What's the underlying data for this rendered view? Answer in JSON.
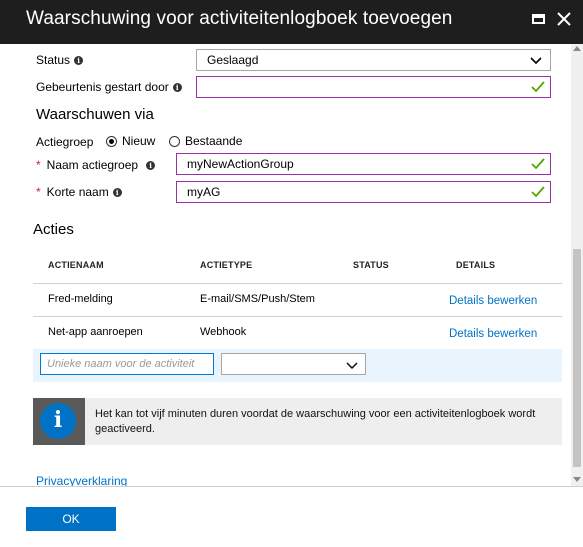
{
  "window": {
    "title": "Waarschuwing voor activiteitenlogboek toevoegen"
  },
  "form": {
    "status_label": "Status",
    "status_value": "Geslaagd",
    "event_initiated_label": "Gebeurtenis gestart door",
    "event_initiated_value": ""
  },
  "notify": {
    "section_title": "Waarschuwen via",
    "action_group_label": "Actiegroep",
    "option_new": "Nieuw",
    "option_existing": "Bestaande",
    "selected_option": "Nieuw",
    "group_name_label": "Naam actiegroep",
    "group_name_value": "myNewActionGroup",
    "short_name_label": "Korte naam",
    "short_name_value": "myAG"
  },
  "actions": {
    "section_title": "Acties",
    "columns": [
      "ACTIENAAM",
      "ACTIETYPE",
      "STATUS",
      "DETAILS"
    ],
    "rows": [
      {
        "name": "Fred-melding",
        "type": "E-mail/SMS/Push/Stem",
        "status": "",
        "details": "Details bewerken"
      },
      {
        "name": "Net-app aanroepen",
        "type": "Webhook",
        "status": "",
        "details": "Details bewerken"
      }
    ],
    "new_name_placeholder": "Unieke naam voor de activiteit",
    "new_type_value": ""
  },
  "info_message": "Het kan tot vijf minuten duren voordat de waarschuwing voor een activiteitenlogboek wordt geactiveerd.",
  "privacy_link": "Privacyverklaring",
  "ok_button": "OK",
  "colors": {
    "accent": "#0072c6",
    "titlebar": "#1e1e1e",
    "valid_check": "#57a300",
    "field_border": "#9b2fa8",
    "required": "#c4262e"
  }
}
